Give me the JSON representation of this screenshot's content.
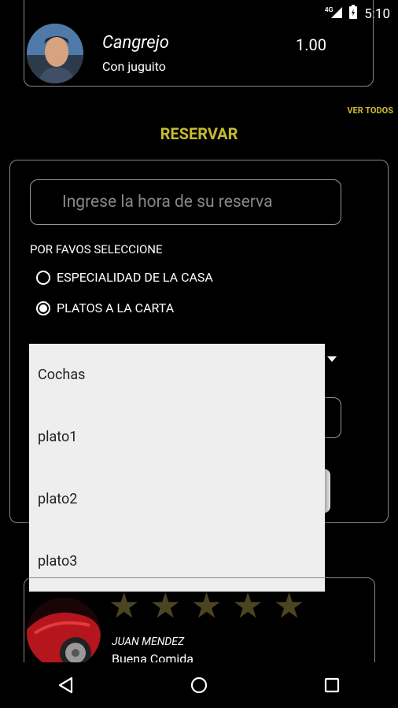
{
  "status_bar": {
    "time": "5:10",
    "signal_label": "4G"
  },
  "order": {
    "name": "Cangrejo",
    "description": "Con juguito",
    "price": "1.00"
  },
  "ver_todos": "VER TODOS",
  "reservar_title": "RESERVAR",
  "reservation": {
    "time_placeholder": "Ingrese la hora de su reserva",
    "select_label": "POR FAVOS SELECCIONE",
    "options": [
      {
        "label": "ESPECIALIDAD DE LA CASA",
        "selected": false
      },
      {
        "label": "PLATOS A LA CARTA",
        "selected": true
      }
    ]
  },
  "dropdown": {
    "items": [
      "Cochas",
      "plato1",
      "plato2",
      "plato3"
    ]
  },
  "review": {
    "name": "JUAN MENDEZ",
    "comment": "Buena Comida",
    "stars": 5
  },
  "colors": {
    "accent": "#c7bb2d",
    "star": "#4a4421"
  }
}
